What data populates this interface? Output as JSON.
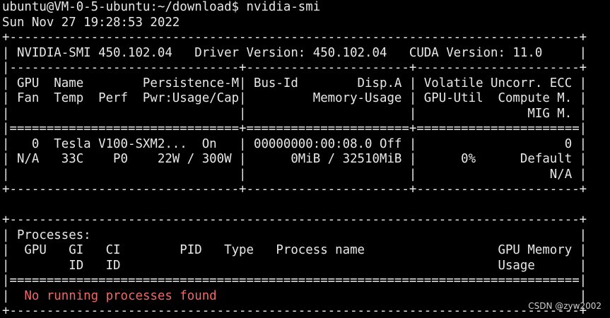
{
  "terminal": {
    "foreground": "#e8e8e8",
    "background": "#000000",
    "error_color": "#f06868",
    "prompt": "ubuntu@VM-0-5-ubuntu:~/download$ nvidia-smi",
    "timestamp": "Sun Nov 27 19:28:53 2022",
    "gpu_table": {
      "border_top": "+-----------------------------------------------------------------------------+",
      "version_row": "| NVIDIA-SMI 450.102.04   Driver Version: 450.102.04   CUDA Version: 11.0     |",
      "separator": "|-------------------------------+----------------------+----------------------+",
      "header_row_1": "| GPU  Name        Persistence-M| Bus-Id        Disp.A | Volatile Uncorr. ECC |",
      "header_row_2": "| Fan  Temp  Perf  Pwr:Usage/Cap|         Memory-Usage | GPU-Util  Compute M. |",
      "header_row_3": "|                               |                      |               MIG M. |",
      "double_separator": "|===============================+======================+======================|",
      "gpu_row_1": "|   0  Tesla V100-SXM2...  On   | 00000000:00:08.0 Off |                    0 |",
      "gpu_row_2": "| N/A   33C    P0    22W / 300W |      0MiB / 32510MiB |      0%      Default |",
      "gpu_row_3": "|                               |                      |                  N/A |",
      "border_bottom": "+-------------------------------+----------------------+----------------------+"
    },
    "process_table": {
      "border_top": "+-----------------------------------------------------------------------------+",
      "title_row": "| Processes:                                                                  |",
      "header_row_1": "|  GPU   GI   CI        PID   Type   Process name                  GPU Memory |",
      "header_row_2": "|        ID   ID                                                   Usage      |",
      "double_separator": "|=============================================================================|",
      "message_row": "|  No running processes found                                                 |",
      "border_bottom": "+-----------------------------------------------------------------------------+"
    }
  },
  "watermark": "CSDN @zyw2002"
}
